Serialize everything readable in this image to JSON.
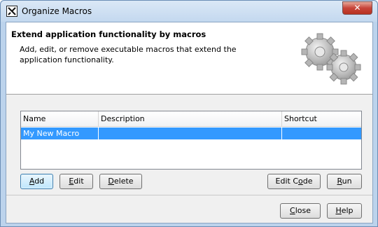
{
  "window": {
    "title": "Organize Macros",
    "close_glyph": "✕"
  },
  "header": {
    "title": "Extend application functionality by macros",
    "description": "Add, edit, or remove executable macros that extend the application functionality.",
    "illustration_icon": "gears-icon"
  },
  "table": {
    "columns": [
      "Name",
      "Description",
      "Shortcut"
    ],
    "rows": [
      {
        "name": "My New Macro",
        "description": "",
        "shortcut": "",
        "selected": true
      }
    ]
  },
  "buttons": {
    "add": {
      "mnemonic": "A",
      "rest": "dd"
    },
    "edit": {
      "mnemonic": "E",
      "rest": "dit"
    },
    "delete": {
      "mnemonic": "D",
      "rest": "elete"
    },
    "edit_code": {
      "pre": "Edit C",
      "mnemonic": "o",
      "rest": "de"
    },
    "run": {
      "mnemonic": "R",
      "rest": "un"
    },
    "close": {
      "mnemonic": "C",
      "rest": "lose"
    },
    "help": {
      "mnemonic": "H",
      "rest": "elp"
    }
  },
  "colors": {
    "selection": "#3399ff",
    "title_close": "#c7443a"
  }
}
